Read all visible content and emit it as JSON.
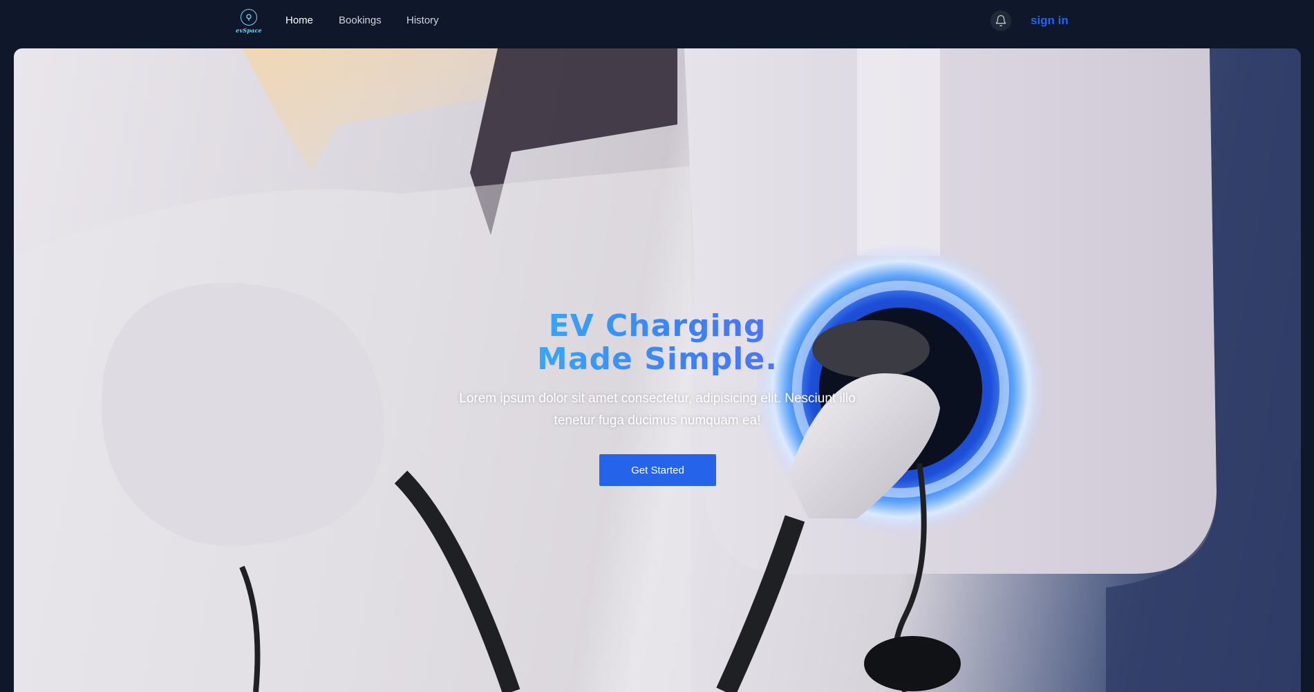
{
  "brand": {
    "logo_text": "evSpace"
  },
  "nav": {
    "items": [
      {
        "label": "Home",
        "active": true
      },
      {
        "label": "Bookings",
        "active": false
      },
      {
        "label": "History",
        "active": false
      }
    ],
    "signin_label": "sign in"
  },
  "icons": {
    "logo": "ev-pin-icon",
    "notifications": "bell-icon"
  },
  "hero": {
    "title_line1": "EV Charging",
    "title_line2": "Made Simple.",
    "description": "Lorem ipsum dolor sit amet consectetur, adipisicing elit. Nesciunt illo tenetur fuga ducimus numquam ea!",
    "cta_label": "Get Started"
  },
  "colors": {
    "background": "#0f172a",
    "accent": "#2563eb",
    "title_gradient_start": "#38bdf8",
    "title_gradient_end": "#6366f1"
  }
}
